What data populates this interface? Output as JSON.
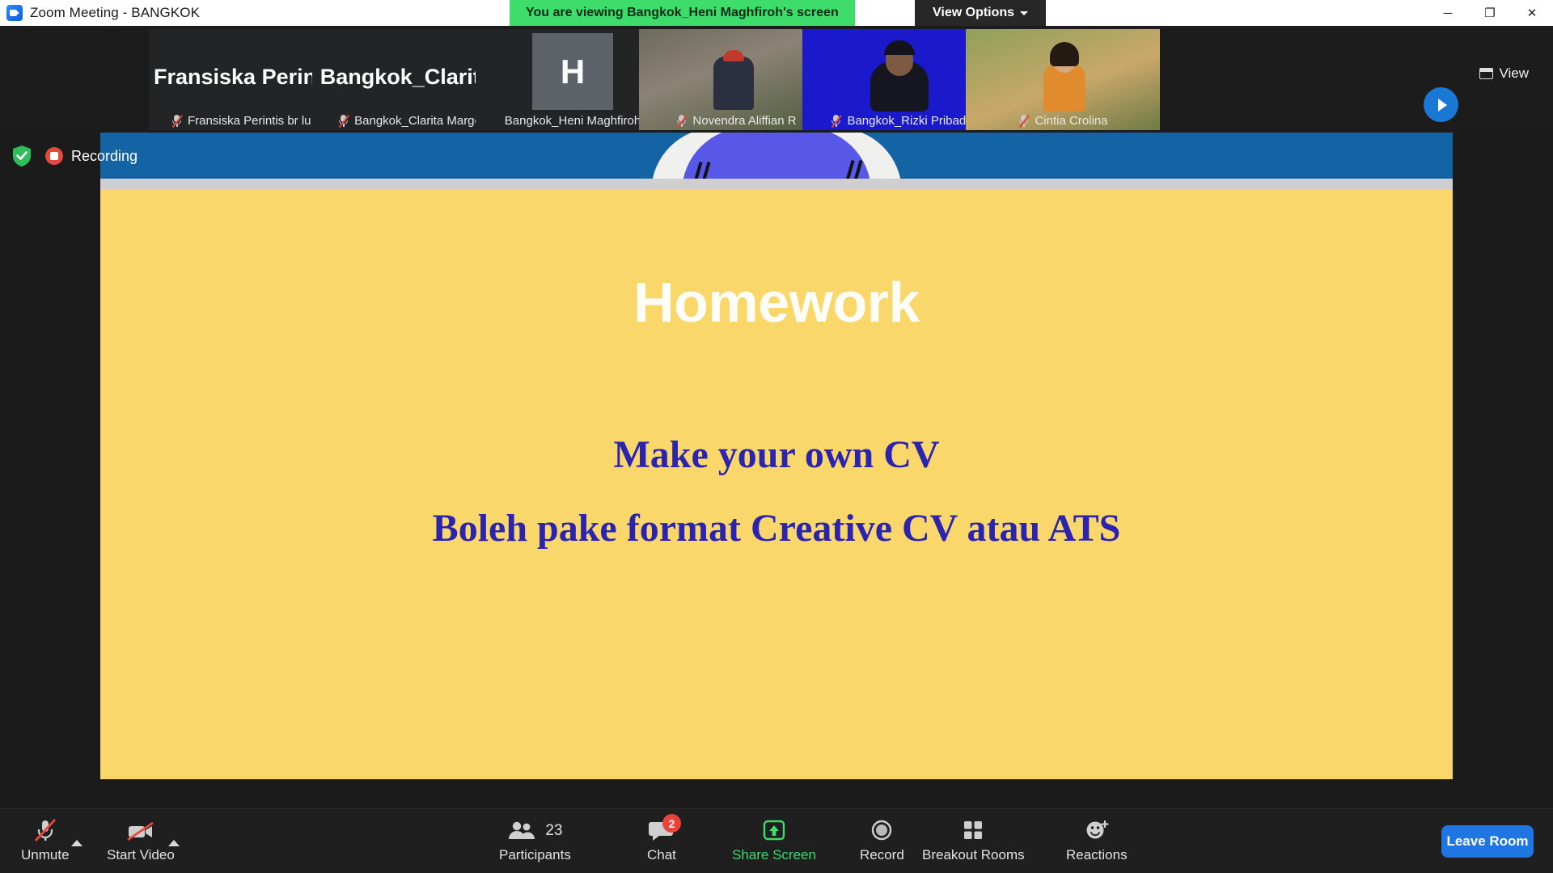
{
  "titlebar": {
    "app_title": "Zoom Meeting - BANGKOK",
    "logo_icon": "zoom-logo-icon",
    "share_banner": "You are viewing Bangkok_Heni Maghfiroh's screen",
    "view_options_label": "View Options",
    "chevron_icon": "chevron-down-icon",
    "minimize_icon": "minimize-icon",
    "maximize_icon": "maximize-icon",
    "close_icon": "close-icon",
    "minimize_glyph": "─",
    "maximize_glyph": "❐",
    "close_glyph": "✕",
    "banner_color": "#3ddc6b"
  },
  "filmstrip": {
    "view_button_label": "View",
    "view_icon": "gallery-view-icon",
    "next_icon": "chevron-right-icon",
    "thumbnails": [
      {
        "display_name": "Fransiska Perintis br lu...",
        "overlay_name": "Fransiska  Perint...",
        "kind": "name-only",
        "muted": true,
        "active": false
      },
      {
        "display_name": "Bangkok_Clarita Margo",
        "overlay_name": "Bangkok_Clarit...",
        "kind": "name-only",
        "muted": true,
        "active": false
      },
      {
        "display_name": "Bangkok_Heni Maghfiroh",
        "overlay_name": "H",
        "kind": "initial",
        "muted": false,
        "active": true
      },
      {
        "display_name": "Novendra Aliffian R",
        "overlay_name": "",
        "kind": "video-rock",
        "muted": true,
        "active": false
      },
      {
        "display_name": "Bangkok_Rizki Pribadi",
        "overlay_name": "",
        "kind": "video-blue",
        "muted": true,
        "active": false
      },
      {
        "display_name": "Cintia Crolina",
        "overlay_name": "",
        "kind": "video-outdoor",
        "muted": true,
        "active": false
      }
    ]
  },
  "stage": {
    "encryption_icon": "shield-check-icon",
    "recording_icon": "recording-icon",
    "recording_label": "Recording",
    "slide": {
      "title": "Homework",
      "line1": "Make your own CV",
      "line2": "Boleh pake format Creative CV atau ATS",
      "background_color": "#fad76a",
      "title_color": "#fffdf7",
      "body_color": "#2b24b0"
    },
    "cursor_icon": "mouse-pointer-icon"
  },
  "toolbar": {
    "items": [
      {
        "label": "Unmute",
        "icon": "microphone-muted-icon",
        "has_caret": true
      },
      {
        "label": "Start Video",
        "icon": "camera-off-icon",
        "has_caret": true
      },
      {
        "label": "Participants",
        "icon": "participants-icon",
        "count": "23"
      },
      {
        "label": "Chat",
        "icon": "chat-icon",
        "badge": "2"
      },
      {
        "label": "Share Screen",
        "icon": "share-screen-icon",
        "highlight": true
      },
      {
        "label": "Record",
        "icon": "record-circle-icon"
      },
      {
        "label": "Breakout Rooms",
        "icon": "breakout-rooms-icon"
      },
      {
        "label": "Reactions",
        "icon": "reactions-icon"
      }
    ],
    "leave_label": "Leave Room",
    "leave_color": "#1f76e3",
    "accent_green": "#3ddc6b"
  }
}
